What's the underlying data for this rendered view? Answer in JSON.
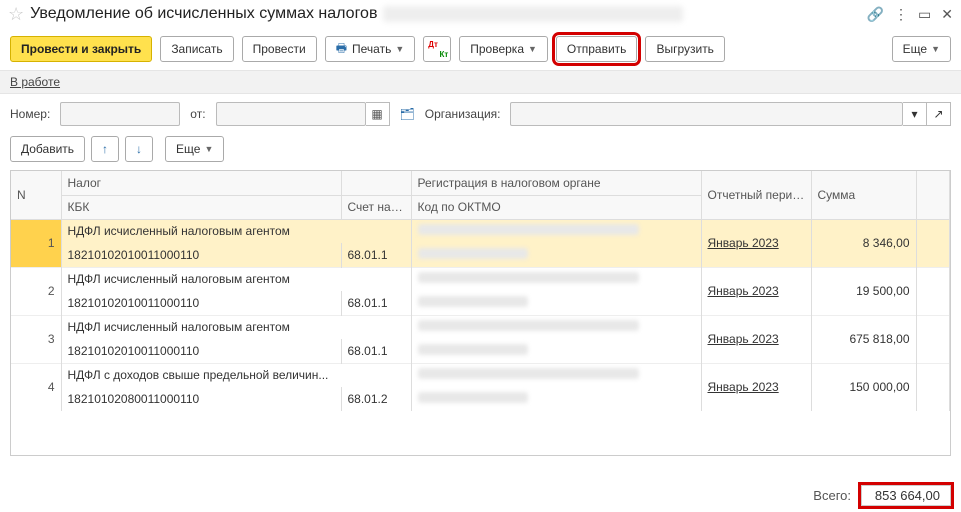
{
  "title": "Уведомление об исчисленных суммах налогов",
  "toolbar": {
    "post_close": "Провести и закрыть",
    "save": "Записать",
    "post": "Провести",
    "print": "Печать",
    "check": "Проверка",
    "send": "Отправить",
    "export": "Выгрузить",
    "more": "Еще"
  },
  "status_link": "В работе",
  "fields": {
    "number_label": "Номер:",
    "from_label": "от:",
    "org_label": "Организация:"
  },
  "toolbar2": {
    "add": "Добавить",
    "more": "Еще"
  },
  "grid": {
    "headers": {
      "n": "N",
      "tax": "Налог",
      "kbk": "КБК",
      "acct": "Счет налога",
      "reg": "Регистрация в налоговом органе",
      "oktmo": "Код по ОКТМО",
      "period": "Отчетный период",
      "sum": "Сумма"
    },
    "rows": [
      {
        "n": "1",
        "tax": "НДФЛ исчисленный налоговым агентом",
        "kbk": "18210102010011000110",
        "acct": "68.01.1",
        "period": "Январь 2023",
        "sum": "8 346,00"
      },
      {
        "n": "2",
        "tax": "НДФЛ исчисленный налоговым агентом",
        "kbk": "18210102010011000110",
        "acct": "68.01.1",
        "period": "Январь 2023",
        "sum": "19 500,00"
      },
      {
        "n": "3",
        "tax": "НДФЛ исчисленный налоговым агентом",
        "kbk": "18210102010011000110",
        "acct": "68.01.1",
        "period": "Январь 2023",
        "sum": "675 818,00"
      },
      {
        "n": "4",
        "tax": "НДФЛ с доходов свыше предельной величин...",
        "kbk": "18210102080011000110",
        "acct": "68.01.2",
        "period": "Январь 2023",
        "sum": "150 000,00"
      }
    ]
  },
  "footer": {
    "label": "Всего:",
    "value": "853 664,00"
  }
}
